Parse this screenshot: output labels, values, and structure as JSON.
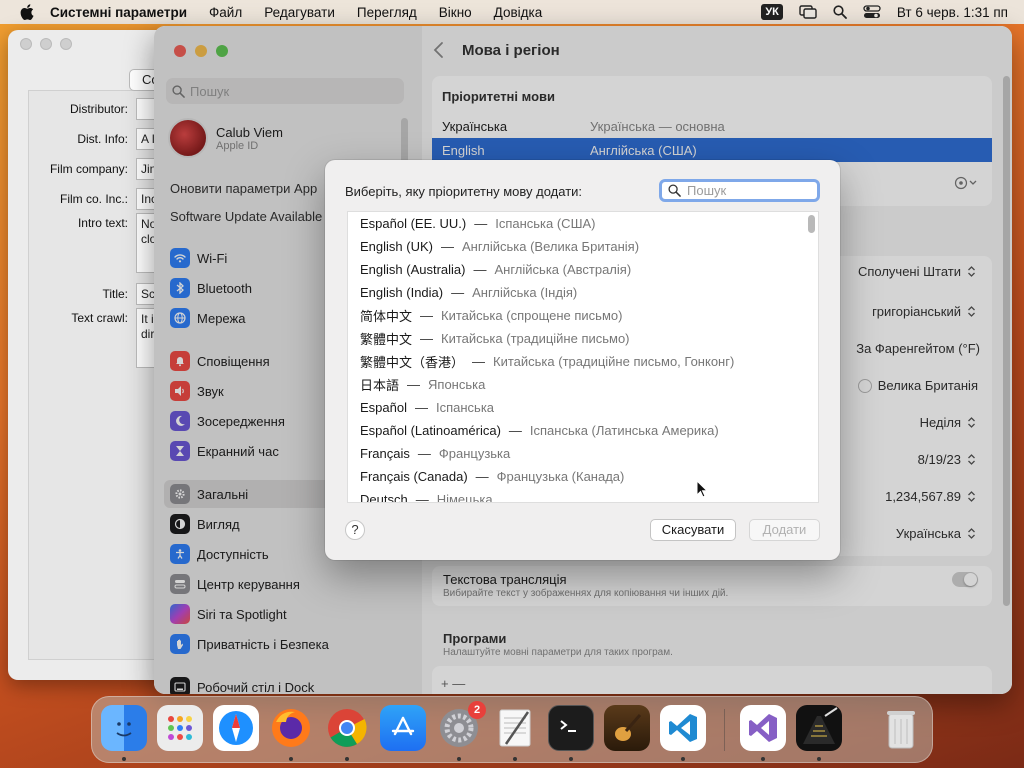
{
  "menubar": {
    "app_name": "Системні параметри",
    "menus": [
      "Файл",
      "Редагувати",
      "Перегляд",
      "Вікно",
      "Довідка"
    ],
    "input_source": "УК",
    "datetime": "Вт 6 черв.  1:31 пп"
  },
  "film_window": {
    "top_button": "Co",
    "fields": [
      {
        "label": "Distributor:",
        "value": ""
      },
      {
        "label": "Dist. Info:",
        "value": "A I"
      },
      {
        "label": "Film company:",
        "value": "Jin"
      },
      {
        "label": "Film co. Inc.:",
        "value": "Inc"
      },
      {
        "label": "Intro text:",
        "value": "No"
      },
      {
        "label": "",
        "value": "clo"
      },
      {
        "label": "Title:",
        "value": "Sc"
      },
      {
        "label": "Text crawl:",
        "value": "It i"
      },
      {
        "label": "",
        "value": "dir"
      }
    ]
  },
  "sidebar": {
    "search_placeholder": "Пошук",
    "user_name": "Calub Viem",
    "user_sub": "Apple ID",
    "update_text": "Оновити параметри App",
    "software_update": "Software Update Available",
    "items": [
      {
        "label": "Wi-Fi",
        "icon": "wifi-icon",
        "color": "#2f7ff7"
      },
      {
        "label": "Bluetooth",
        "icon": "bluetooth-icon",
        "color": "#2f7ff7"
      },
      {
        "label": "Мережа",
        "icon": "globe-icon",
        "color": "#2f7ff7"
      },
      {
        "label": "Сповіщення",
        "icon": "bell-icon",
        "color": "#ee4b45"
      },
      {
        "label": "Звук",
        "icon": "speaker-icon",
        "color": "#ee4b45"
      },
      {
        "label": "Зосередження",
        "icon": "moon-icon",
        "color": "#6c58d6"
      },
      {
        "label": "Екранний час",
        "icon": "hourglass-icon",
        "color": "#6c58d6"
      },
      {
        "label": "Загальні",
        "icon": "gear-icon",
        "color": "#8e8e93"
      },
      {
        "label": "Вигляд",
        "icon": "appearance-icon",
        "color": "#1c1c1e"
      },
      {
        "label": "Доступність",
        "icon": "accessibility-icon",
        "color": "#2f7ff7"
      },
      {
        "label": "Центр керування",
        "icon": "control-center-icon",
        "color": "#8e8e93"
      },
      {
        "label": "Siri та Spotlight",
        "icon": "siri-icon",
        "color": "#c04bd6"
      },
      {
        "label": "Приватність і Безпека",
        "icon": "hand-icon",
        "color": "#2f7ff7"
      },
      {
        "label": "Робочий стіл і Dock",
        "icon": "desktop-icon",
        "color": "#1c1c1e"
      }
    ]
  },
  "content": {
    "title": "Мова і регіон",
    "preferred_title": "Пріоритетні мови",
    "languages": [
      {
        "name": "Українська",
        "desc": "Українська — основна"
      },
      {
        "name": "English",
        "desc": "Англійська (США)"
      }
    ],
    "values": {
      "region": "Сполучені Штати",
      "calendar": "григоріанський",
      "temperature": "За Фаренгейтом (°F)",
      "measurement": "Велика Британія",
      "first_day": "Неділя",
      "date_format": "8/19/23",
      "number_format": "1,234,567.89",
      "list_sort": "Українська"
    },
    "live_text_title": "Текстова трансляція",
    "live_text_desc": "Вибирайте текст у зображеннях для копіювання чи інших дій.",
    "apps_title": "Програми",
    "apps_desc": "Налаштуйте мовні параметри для таких програм.",
    "add_remove": "+  —"
  },
  "dialog": {
    "prompt": "Виберіть, яку пріоритетну мову додати:",
    "search_placeholder": "Пошук",
    "items": [
      {
        "name": "Español (EE. UU.)",
        "desc": "Іспанська (США)"
      },
      {
        "name": "English (UK)",
        "desc": "Англійська (Велика Британія)"
      },
      {
        "name": "English (Australia)",
        "desc": "Англійська (Австралія)"
      },
      {
        "name": "English (India)",
        "desc": "Англійська (Індія)"
      },
      {
        "name": "简体中文",
        "desc": "Китайська (спрощене письмо)"
      },
      {
        "name": "繁體中文",
        "desc": "Китайська (традиційне письмо)"
      },
      {
        "name": "繁體中文（香港）",
        "desc": "Китайська (традиційне письмо, Гонконг)"
      },
      {
        "name": "日本語",
        "desc": "Японська"
      },
      {
        "name": "Español",
        "desc": "Іспанська"
      },
      {
        "name": "Español (Latinoamérica)",
        "desc": "Іспанська (Латинська Америка)"
      },
      {
        "name": "Français",
        "desc": "Французька"
      },
      {
        "name": "Français (Canada)",
        "desc": "Французька (Канада)"
      },
      {
        "name": "Deutsch",
        "desc": "Німецька"
      }
    ],
    "help": "?",
    "cancel": "Скасувати",
    "add": "Додати"
  },
  "dock": {
    "apps": [
      {
        "name": "finder-icon",
        "color": "#3b8df5"
      },
      {
        "name": "launchpad-icon",
        "color": "#e6e6e6"
      },
      {
        "name": "safari-icon",
        "color": "#1e90ff"
      },
      {
        "name": "firefox-icon",
        "color": "#ff7a1a"
      },
      {
        "name": "chrome-icon",
        "color": "#ffffff"
      },
      {
        "name": "app-store-icon",
        "color": "#1e7cf2"
      },
      {
        "name": "system-settings-icon",
        "color": "#8e8e93"
      },
      {
        "name": "script-editor-icon",
        "color": "#f2f2f2"
      },
      {
        "name": "terminal-icon",
        "color": "#1a1a1a"
      },
      {
        "name": "garageband-icon",
        "color": "#e0a040"
      },
      {
        "name": "vscode-icon",
        "color": "#ffffff"
      },
      {
        "name": "visual-studio-icon",
        "color": "#ffffff"
      },
      {
        "name": "crawl-app-icon",
        "color": "#111111"
      },
      {
        "name": "trash-icon",
        "color": "#dcdcdc"
      }
    ],
    "settings_badge": "2"
  }
}
